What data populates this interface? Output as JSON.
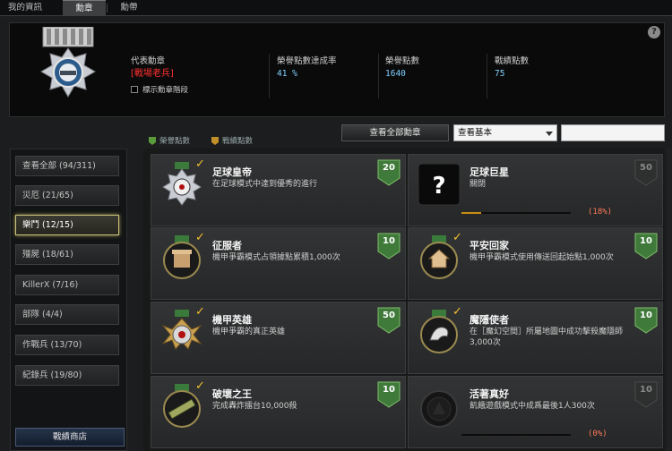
{
  "tabs": [
    "我的資訊",
    "勳章",
    "勳帶"
  ],
  "header": {
    "rep_label": "代表勳章",
    "rep_name": "[戰場老兵]",
    "show_grade": "標示勳章階段",
    "rate_label": "榮譽點數達成率",
    "rate_value": "41 %",
    "honor_label": "榮譽點數",
    "honor_value": "1640",
    "combat_label": "戰績點數",
    "combat_value": "75",
    "help": "?"
  },
  "legend": {
    "honor": "榮譽點數",
    "combat": "戰績點數",
    "honor_color": "#5a9a3a",
    "combat_color": "#c0902a"
  },
  "controls": {
    "view_all": "查看全部勳章",
    "select_value": "查看基本",
    "search_value": ""
  },
  "sidebar": {
    "items": [
      {
        "label": "查看全部 (94/311)"
      },
      {
        "label": "災厄 (21/65)"
      },
      {
        "label": "樂鬥 (12/15)",
        "active": true
      },
      {
        "label": "殭屍 (18/61)"
      },
      {
        "label": "KillerX (7/16)"
      },
      {
        "label": "部隊 (4/4)"
      },
      {
        "label": "作戰兵 (13/70)"
      },
      {
        "label": "紀錄兵 (19/80)"
      }
    ],
    "shop": "戰績商店"
  },
  "cards": [
    {
      "name": "足球皇帝",
      "desc": "在足球模式中達到優秀的進行",
      "points": "20",
      "done": true,
      "icon": "soccer-medal-icon"
    },
    {
      "name": "足球巨星",
      "desc": "關閉",
      "points": "50",
      "done": false,
      "icon": "question-icon",
      "progress": 0.18,
      "pct": "(18%)"
    },
    {
      "name": "征服者",
      "desc": "機甲爭霸模式占領據點累積1,000次",
      "points": "10",
      "done": true,
      "icon": "fortress-medal-icon"
    },
    {
      "name": "平安回家",
      "desc": "機甲爭霸模式使用傳送回起始點1,000次",
      "points": "10",
      "done": true,
      "icon": "home-medal-icon"
    },
    {
      "name": "機甲英雄",
      "desc": "機甲爭霸的真正英雄",
      "points": "50",
      "done": true,
      "icon": "mech-hero-medal-icon"
    },
    {
      "name": "魔隱使者",
      "desc": "在［魔幻空間］所屬地圖中成功擊殺魔隱師3,000次",
      "points": "10",
      "done": true,
      "icon": "eagle-medal-icon"
    },
    {
      "name": "破壞之王",
      "desc": "完成轟炸擂台10,000殺",
      "points": "10",
      "done": true,
      "icon": "destroyer-medal-icon"
    },
    {
      "name": "活著真好",
      "desc": "飢餓遊戲模式中成爲最後1人300次",
      "points": "10",
      "done": false,
      "icon": "survivor-medal-icon",
      "progress": 0,
      "pct": "(0%)"
    }
  ]
}
